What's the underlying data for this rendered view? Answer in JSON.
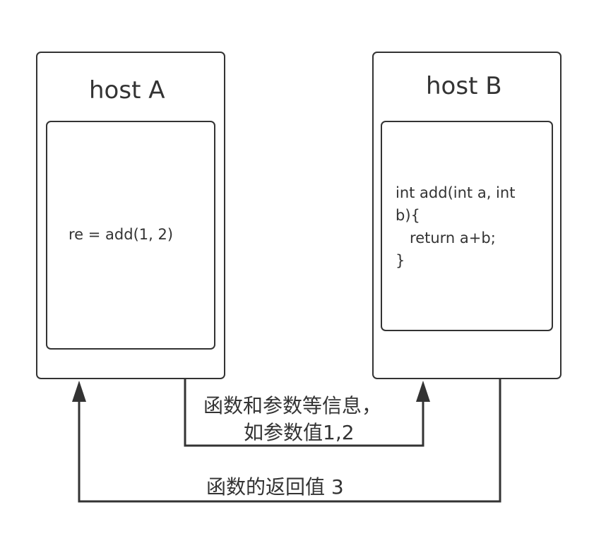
{
  "host_a": {
    "title": "host A",
    "code": "re = add(1, 2)"
  },
  "host_b": {
    "title": "host B",
    "code": "int add(int a, int\nb){\n   return a+b;\n}"
  },
  "edges": {
    "call_label_line1": "函数和参数等信息，",
    "call_label_line2": "如参数值1,2",
    "return_label": "函数的返回值 3"
  },
  "colors": {
    "stroke": "#333333",
    "background": "#ffffff"
  }
}
